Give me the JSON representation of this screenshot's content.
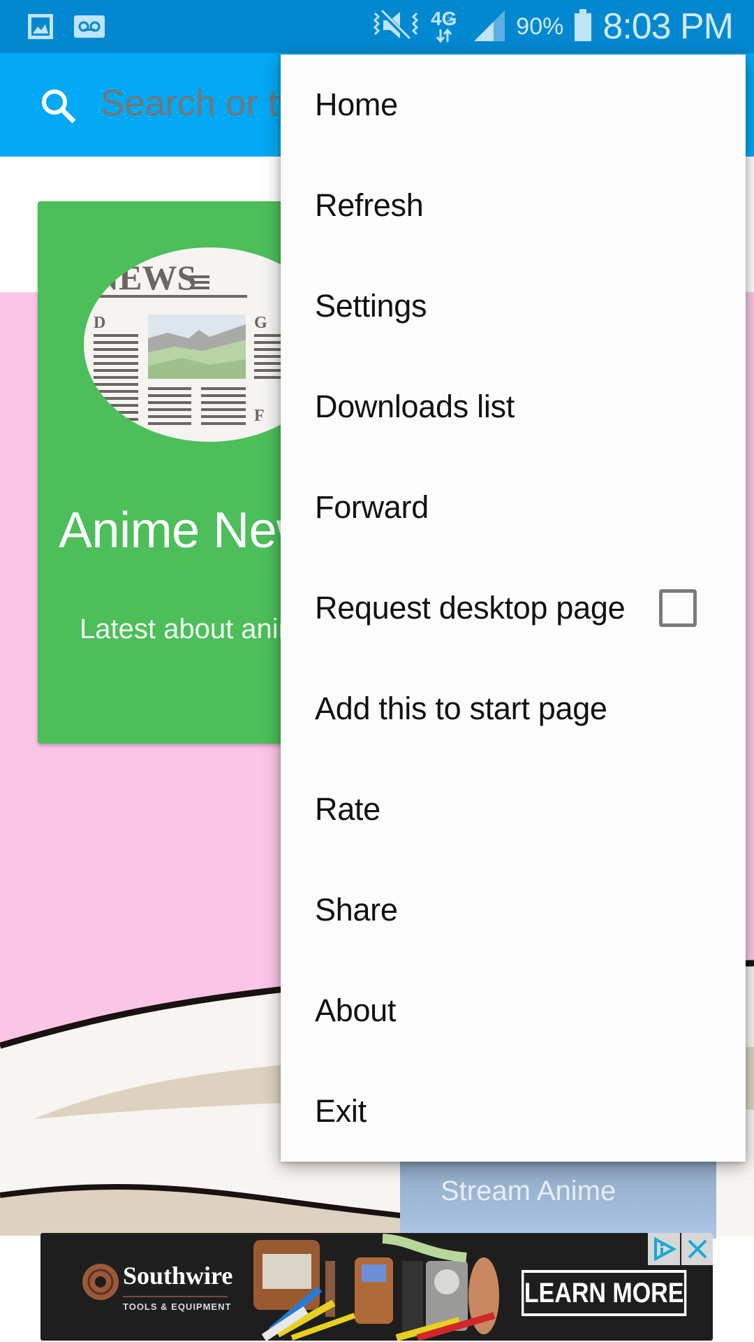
{
  "status_bar": {
    "notification_icons": [
      "gallery-icon",
      "voicemail-icon"
    ],
    "system_icons": [
      "vibrate-mute-icon",
      "4g-lte-icon",
      "signal-icon",
      "battery-icon"
    ],
    "battery": "90%",
    "time": "8:03 PM"
  },
  "search": {
    "placeholder": "Search or type URL",
    "icon": "search-icon"
  },
  "cards": [
    {
      "title": "Anime News",
      "description": "Latest about anime",
      "color": "#4cbe5a"
    },
    {
      "title": "Stream Anime"
    }
  ],
  "menu": {
    "items": [
      {
        "label": "Home"
      },
      {
        "label": "Refresh"
      },
      {
        "label": "Settings"
      },
      {
        "label": "Downloads list"
      },
      {
        "label": "Forward"
      },
      {
        "label": "Request desktop page",
        "checkbox": true,
        "checked": false
      },
      {
        "label": "Add this to start page"
      },
      {
        "label": "Rate"
      },
      {
        "label": "Share"
      },
      {
        "label": "About"
      },
      {
        "label": "Exit"
      }
    ]
  },
  "ad": {
    "brand": "Southwire",
    "tagline": "TOOLS & EQUIPMENT",
    "cta": "LEARN MORE",
    "adchoices_icon": "adchoices-icon",
    "close_icon": "close-icon"
  },
  "colors": {
    "status_bar": "#0288d1",
    "toolbar": "#03a9f4",
    "page_background": "#fbc6e6"
  }
}
